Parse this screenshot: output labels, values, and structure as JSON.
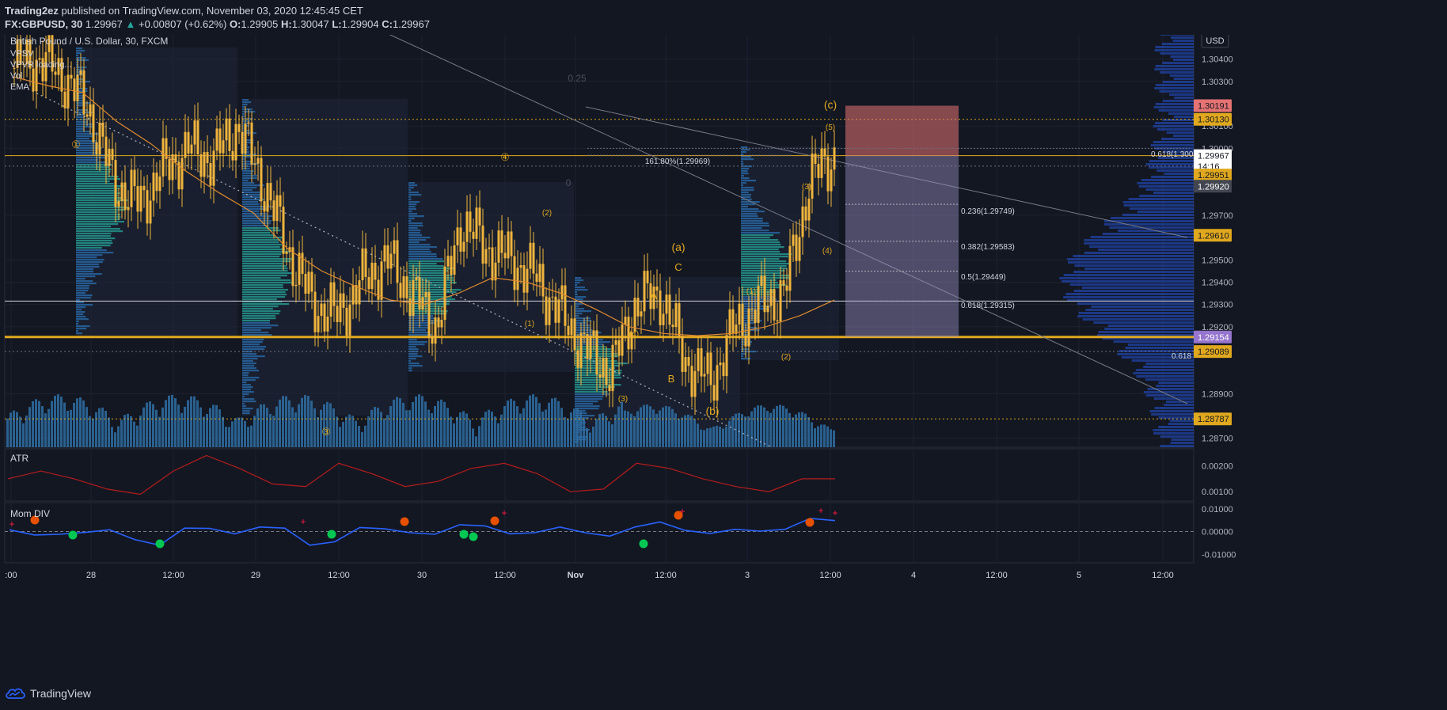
{
  "header": {
    "publisher": "Trading2ez",
    "published_text": "published on TradingView.com, November 03, 2020 12:45:45 CET",
    "symbol": "FX:GBPUSD, 30",
    "price": "1.29967",
    "change": "+0.00807 (+0.62%)",
    "o_label": "O:",
    "o": "1.29905",
    "h_label": "H:",
    "h": "1.30047",
    "l_label": "L:",
    "l": "1.29904",
    "c_label": "C:",
    "c": "1.29967"
  },
  "legend": {
    "title": "British Pound / U.S. Dollar, 30, FXCM",
    "items": [
      "VPSV",
      "VPVR loading...",
      "Vol",
      "EMA"
    ]
  },
  "currency_button": "USD",
  "footer": {
    "brand": "TradingView"
  },
  "colors": {
    "background": "#131722",
    "candle": "#f0b43c",
    "ema": "#e08a2e",
    "atr": "#b71c1c",
    "mom": "#2962ff",
    "volume": "#2f6ea3",
    "level_gold": "#e0a81e"
  },
  "chart_data": [
    {
      "type": "candlestick",
      "title": "British Pound / U.S. Dollar, 30, FXCM",
      "x_ticks": [
        ":00",
        "28",
        "12:00",
        "29",
        "12:00",
        "30",
        "12:00",
        "Nov",
        "12:00",
        "3",
        "12:00",
        "4",
        "12:00",
        "5",
        "12:00"
      ],
      "y_ticks": [
        "1.30400",
        "1.30300",
        "1.30100",
        "1.30000",
        "1.29700",
        "1.29500",
        "1.29400",
        "1.29300",
        "1.29200",
        "1.28900",
        "1.28700"
      ],
      "ylim": [
        1.2866,
        1.3053
      ],
      "price_labels": [
        {
          "text": "1.30191",
          "value": 1.30191,
          "color": "#e57373"
        },
        {
          "text": "1.30130",
          "value": 1.3013,
          "color": "#e0a81e"
        },
        {
          "text": "1.29967",
          "value": 1.29967,
          "color": "#ffffff"
        },
        {
          "text": "14:16",
          "value": 1.2992,
          "color": "#ffffff"
        },
        {
          "text": "1.29951",
          "value": 1.2988,
          "color": "#e0a81e"
        },
        {
          "text": "1.29920",
          "value": 1.2983,
          "color": "#434651"
        },
        {
          "text": "1.29610",
          "value": 1.2961,
          "color": "#e0a81e"
        },
        {
          "text": "1.29154",
          "value": 1.29154,
          "color": "#9575cd"
        },
        {
          "text": "1.29089",
          "value": 1.29089,
          "color": "#e0a81e"
        },
        {
          "text": "1.28787",
          "value": 1.28787,
          "color": "#e0a81e"
        }
      ],
      "fib_labels": [
        "161.80%(1.29969)",
        "0.236(1.29749)",
        "0.382(1.29583)",
        "0.5(1.29449)",
        "0.618(1.29315)",
        "0.618(1.300",
        "0.618",
        "0.25",
        "0"
      ],
      "wave_labels": [
        "①",
        "④",
        "③",
        "(2)",
        "(1)",
        "(4)",
        "(3)",
        "(a)",
        "C",
        "A",
        "B",
        "(b)",
        "(c)",
        "(5)",
        "(3)",
        "(4)",
        "(1)",
        "(2)"
      ],
      "horizontal_levels": [
        1.29967,
        1.29315,
        1.29154
      ],
      "series": [
        {
          "name": "EMA",
          "values": [
            1.3032,
            1.3028,
            1.3025,
            1.3012,
            1.3002,
            1.299,
            1.298,
            1.2971,
            1.2955,
            1.2945,
            1.2938,
            1.2932,
            1.293,
            1.2935,
            1.2942,
            1.294,
            1.2935,
            1.2928,
            1.292,
            1.2917,
            1.2916,
            1.2917,
            1.292,
            1.2925,
            1.2932
          ]
        }
      ],
      "close": [
        1.3036,
        1.304,
        1.3032,
        1.3018,
        1.2985,
        1.2975,
        1.299,
        1.3,
        1.2995,
        1.301,
        1.2985,
        1.2955,
        1.293,
        1.2925,
        1.294,
        1.295,
        1.2935,
        1.292,
        1.2968,
        1.2955,
        1.295,
        1.2942,
        1.2925,
        1.291,
        1.29,
        1.293,
        1.2935,
        1.2905,
        1.2895,
        1.292,
        1.293,
        1.2935,
        1.2985,
        1.2997
      ]
    },
    {
      "type": "line",
      "title": "ATR",
      "y_ticks": [
        "0.00200",
        "0.00100"
      ],
      "ylim": [
        0.0007,
        0.0026
      ],
      "values": [
        0.0015,
        0.0018,
        0.0015,
        0.0011,
        0.0009,
        0.0018,
        0.0024,
        0.0019,
        0.0013,
        0.0012,
        0.0021,
        0.0017,
        0.0012,
        0.0014,
        0.0019,
        0.0021,
        0.0017,
        0.001,
        0.0011,
        0.0021,
        0.0019,
        0.0015,
        0.0012,
        0.001,
        0.0015,
        0.0015
      ]
    },
    {
      "type": "line",
      "title": "Mom DIV",
      "y_ticks": [
        "0.01000",
        "0.00000",
        "-0.01000"
      ],
      "ylim": [
        -0.013,
        0.012
      ],
      "values": [
        0.0008,
        -0.0015,
        -0.0012,
        -0.0004,
        0.0008,
        -0.0035,
        -0.006,
        0.0015,
        0.0014,
        -0.001,
        0.002,
        0.0015,
        -0.006,
        -0.0045,
        0.0018,
        0.0012,
        -0.0005,
        -0.0012,
        0.003,
        0.0025,
        -0.001,
        -0.0005,
        0.002,
        -0.0005,
        -0.002,
        0.002,
        0.0042,
        0.0005,
        -0.0008,
        0.001,
        0.0002,
        0.001,
        0.0058,
        0.0048
      ]
    }
  ]
}
